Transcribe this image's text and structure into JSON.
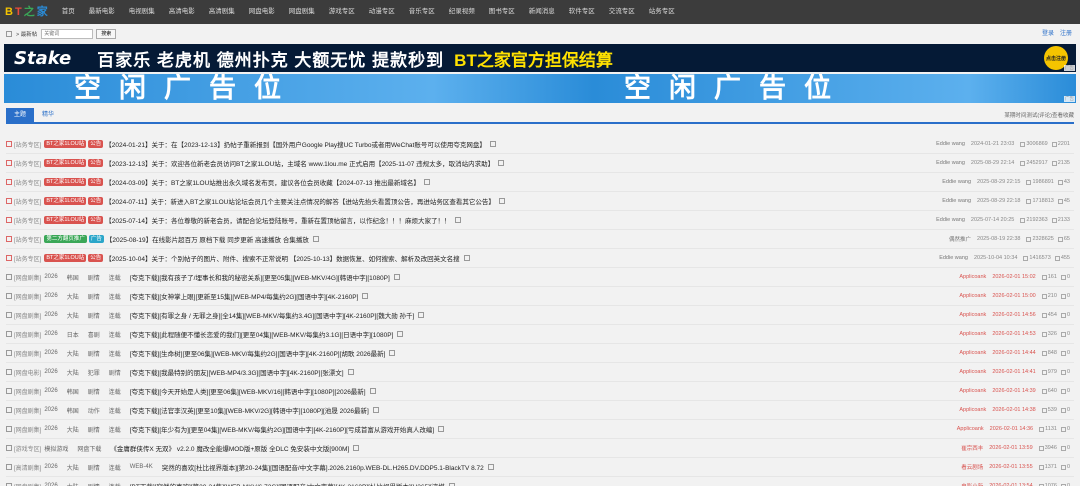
{
  "nav": {
    "logo": [
      "B",
      "T",
      "之",
      "家"
    ],
    "logo_colors": [
      "#f5c400",
      "#e94b3c",
      "#3aa757",
      "#2a8cd8"
    ],
    "items": [
      "首页",
      "最新电影",
      "电视剧集",
      "高清电影",
      "高清剧集",
      "网盘电影",
      "网盘剧集",
      "游戏专区",
      "动漫专区",
      "音乐专区",
      "纪录视频",
      "图书专区",
      "新闻消息",
      "软件专区",
      "交流专区",
      "站务专区"
    ]
  },
  "search": {
    "label": "> 最新帖",
    "placeholder": "关键词",
    "button": "搜索"
  },
  "toplinks": [
    "登录",
    "注册"
  ],
  "banner1": {
    "brand": "Stake",
    "slogan": "百家乐 老虎机 德州扑克 大额无忧 提款秒到",
    "slogan2": "BT之家官方担保结算",
    "badge": "点击注册",
    "ad": "广告"
  },
  "banner2": {
    "text": "空闲广告位",
    "ad": "广告"
  },
  "tabs": {
    "items": [
      "主题",
      "精华"
    ],
    "hint": "某期时间测试(评论)查看收藏"
  },
  "rows": [
    {
      "type": "sticky",
      "cat": "[站务专区]",
      "pills": [
        [
          "BT之家1LOU站",
          "red"
        ],
        [
          "公告",
          "red"
        ]
      ],
      "title": "【2024-01-21】关于：在【2023-12-13】扔帖子重新报到【国外用户Google Play搜UC Turbo或者用WeChat账号可以使用夸克网盘】",
      "author": "Eddie wang",
      "date": "2024-01-21 23:03",
      "views": "3006869",
      "replies": "2201"
    },
    {
      "type": "sticky",
      "cat": "[站务专区]",
      "pills": [
        [
          "BT之家1LOU站",
          "red"
        ],
        [
          "公告",
          "red"
        ]
      ],
      "title": "【2023-12-13】关于：欢迎各位新老会员访问BT之家1LOU站，主域名 www.1lou.me 正式启用【2025-11-07 违规太多，取消站内求助】",
      "author": "Eddie wang",
      "date": "2025-08-29 22:14",
      "views": "2452917",
      "replies": "2135"
    },
    {
      "type": "sticky",
      "cat": "[站务专区]",
      "pills": [
        [
          "BT之家1LOU站",
          "red"
        ],
        [
          "公告",
          "red"
        ]
      ],
      "title": "【2024-03-09】关于：BT之家1LOU站推出永久域名发布页，建议各位会员收藏【2024-07-13 推出最新域名】",
      "author": "Eddie wang",
      "date": "2025-08-29 22:15",
      "views": "1986891",
      "replies": "43"
    },
    {
      "type": "sticky",
      "cat": "[站务专区]",
      "pills": [
        [
          "BT之家1LOU站",
          "red"
        ],
        [
          "公告",
          "red"
        ]
      ],
      "title": "【2024-07-11】关于：新进入BT之家1LOU站论坛会员几个主要关注点情况的解答【进站先抬头看置顶公告，再进站务区查看其它公告】",
      "author": "Eddie wang",
      "date": "2025-08-29 22:18",
      "views": "1718813",
      "replies": "45"
    },
    {
      "type": "sticky",
      "cat": "[站务专区]",
      "pills": [
        [
          "BT之家1LOU站",
          "red"
        ],
        [
          "公告",
          "red"
        ]
      ],
      "title": "【2025-07-14】关于：各位尊敬的新老会员，请配合论坛登陆账号，重新在置顶帖留言，以作纪念！！！麻烦大家了！！",
      "author": "Eddie wang",
      "date": "2025-07-14 20:25",
      "views": "2192363",
      "replies": "2133"
    },
    {
      "type": "sticky",
      "cat": "[站务专区]",
      "pills": [
        [
          "第二方翻页推广",
          "green"
        ],
        [
          "广告",
          "cyan"
        ]
      ],
      "title": "【2025-08-19】在线影片超百万 原档下载 同步更新 高速播放 合集播放",
      "author": "偶然推广",
      "date": "2025-08-19 22:38",
      "views": "2328625",
      "replies": "65"
    },
    {
      "type": "sticky",
      "cat": "[站务专区]",
      "pills": [
        [
          "BT之家1LOU站",
          "red"
        ],
        [
          "公告",
          "red"
        ]
      ],
      "title": "【2025-10-04】关于：个别帖子的图片、附件、搜索不正常说明 【2025-10-13】数据恢复、如何搜索、解析及改回英文名搜",
      "author": "Eddie wang",
      "date": "2025-10-04 10:34",
      "views": "1416573",
      "replies": "455"
    },
    {
      "type": "normal",
      "cat": "[网盘剧集]",
      "meta": [
        "2026",
        "韩国",
        "剧情",
        "连载"
      ],
      "title": "[夸克下载][我有孩子了/埋事长和我的秘密关系][更至05集][WEB-MKV/4G][韩语中字][1080P]",
      "author": "Applicoank",
      "date": "2026-02-01 15:02",
      "views": "161",
      "replies": "0"
    },
    {
      "type": "normal",
      "cat": "[网盘剧集]",
      "meta": [
        "2026",
        "大陆",
        "剧情",
        "连载"
      ],
      "title": "[夸克下载][女神掌上眼][更新至15集][WEB-MP4/每集约2G][国语中字][4K-2160P]",
      "author": "Applicoank",
      "date": "2026-02-01 15:00",
      "views": "210",
      "replies": "0"
    },
    {
      "type": "normal",
      "cat": "[网盘剧集]",
      "meta": [
        "2026",
        "大陆",
        "剧情",
        "连载"
      ],
      "title": "[夸克下载][有罪之身 / 无罪之身][全14集][WEB-MKV/每集约3.4G][国语中字][4K-2160P][魏大勋 孙千]",
      "author": "Applicoank",
      "date": "2026-02-01 14:56",
      "views": "454",
      "replies": "0"
    },
    {
      "type": "normal",
      "cat": "[网盘剧集]",
      "meta": [
        "2026",
        "日本",
        "喜剧",
        "连载"
      ],
      "title": "[夸克下载][此程随便不懂长恋爱的我们][更至04集][WEB-MKV/每集约3.1G][日语中字][1080P]",
      "author": "Applicoank",
      "date": "2026-02-01 14:53",
      "views": "326",
      "replies": "0"
    },
    {
      "type": "normal",
      "cat": "[网盘剧集]",
      "meta": [
        "2026",
        "大陆",
        "剧情",
        "连载"
      ],
      "title": "[夸克下载][生命树][更至06集][WEB-MKV/每集约2G][国语中字][4K-2160P][胡歌 2026最新]",
      "author": "Applicoank",
      "date": "2026-02-01 14:44",
      "views": "848",
      "replies": "0"
    },
    {
      "type": "normal",
      "cat": "[网盘电影]",
      "meta": [
        "2026",
        "大陆",
        "犯罪",
        "剧情"
      ],
      "title": "[夸克下载][我最特别的朋友][WEB-MP4/3.3G][国语中字][4K-2160P][张漂文]",
      "author": "Applicoank",
      "date": "2026-02-01 14:41",
      "views": "979",
      "replies": "0"
    },
    {
      "type": "normal",
      "cat": "[网盘剧集]",
      "meta": [
        "2026",
        "韩国",
        "剧情",
        "连载"
      ],
      "title": "[夸克下载][今天开始是人类][更至06集][WEB-MKV/16][韩语中字][1080P][2026最新]",
      "author": "Applicoank",
      "date": "2026-02-01 14:39",
      "views": "640",
      "replies": "0"
    },
    {
      "type": "normal",
      "cat": "[网盘剧集]",
      "meta": [
        "2026",
        "韩国",
        "动作",
        "连载"
      ],
      "title": "[夸克下载][法官李汉英][更至10集][WEB-MKV/2G][韩语中字][1080P][池晟 2026最新]",
      "author": "Applicoank",
      "date": "2026-02-01 14:38",
      "views": "539",
      "replies": "0"
    },
    {
      "type": "normal",
      "cat": "[网盘剧集]",
      "meta": [
        "2026",
        "大陆",
        "剧情",
        "连载"
      ],
      "title": "[夸克下载][年少有为][更至04集][WEB-MKV/每集约2G][国语中字][4K-2160P][亏成首富从游戏开始真人改编]",
      "author": "Applicoank",
      "date": "2026-02-01 14:36",
      "views": "1131",
      "replies": "0"
    },
    {
      "type": "normal",
      "cat": "[游戏专区]",
      "meta": [
        "模拟游戏",
        "网盘下载"
      ],
      "title": "《金庸群侠传X 无双》 v2.2.0 魔改全能爆MOD版+原版 全DLC 免安装中文版[900M]",
      "author": "崔宗西丰",
      "date": "2026-02-01 13:59",
      "views": "3946",
      "replies": "0"
    },
    {
      "type": "normal",
      "cat": "[高清剧集]",
      "meta": [
        "2026",
        "大陆",
        "剧情",
        "连载",
        "WEB-4K"
      ],
      "title": "突然的喜欢[杜比视界版本][第20-24集][国语配音/中文字幕].2026.2160p.WEB-DL.H265.DV.DDP5.1-BlackTV 8.72",
      "author": "看云剧场",
      "date": "2026-02-01 13:55",
      "views": "1371",
      "replies": "0"
    },
    {
      "type": "normal",
      "cat": "[网盘剧集]",
      "meta": [
        "2026",
        "大陆",
        "剧情",
        "连载"
      ],
      "title": "[BT下载][突然的喜欢][第20-24集][WEB-MKV/6.72G][国语配音/中文字幕][4K-2160P][杜比视界版本][H265][流媒",
      "author": "电影小新",
      "date": "2026-02-01 13:54",
      "views": "1076",
      "replies": "0"
    }
  ]
}
